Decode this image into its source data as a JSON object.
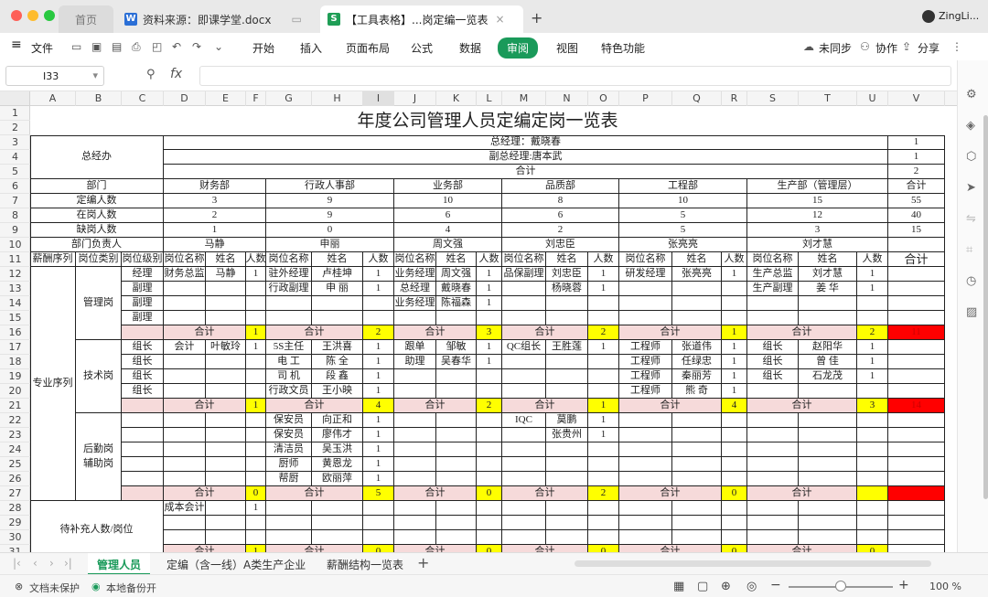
{
  "window": {
    "tabs": [
      {
        "label": "首页"
      },
      {
        "label": "资料来源：即课学堂.docx",
        "icon": "W"
      },
      {
        "label": "【工具表格】...岗定编一览表",
        "icon": "S"
      }
    ],
    "user": "ZingLi..."
  },
  "menu": {
    "file": "文件",
    "items": [
      "开始",
      "插入",
      "页面布局",
      "公式",
      "数据",
      "审阅",
      "视图",
      "特色功能"
    ],
    "active": "审阅",
    "sync": "未同步",
    "collab": "协作",
    "share": "分享"
  },
  "formula": {
    "namebox": "I33",
    "fx": "fx"
  },
  "columns": [
    "A",
    "B",
    "C",
    "D",
    "E",
    "F",
    "G",
    "H",
    "I",
    "J",
    "K",
    "L",
    "M",
    "N",
    "O",
    "P",
    "Q",
    "R",
    "S",
    "T",
    "U",
    "V"
  ],
  "rows": [
    "1",
    "2",
    "3",
    "4",
    "5",
    "6",
    "7",
    "8",
    "9",
    "10",
    "11",
    "12",
    "13",
    "14",
    "15",
    "16",
    "17",
    "18",
    "19",
    "20",
    "21",
    "22",
    "23",
    "24",
    "25",
    "26",
    "27",
    "28",
    "29",
    "30",
    "31"
  ],
  "sheet": {
    "title": "年度公司管理人员定编定岗一览表",
    "zongjingban": "总经办",
    "gm": "总经理：戴晓春",
    "vgm": "副总经理:唐本武",
    "heji": "合计",
    "gm_n": "1",
    "vgm_n": "1",
    "heji_n": "2",
    "dept_label": "部门",
    "depts": [
      "财务部",
      "行政人事部",
      "业务部",
      "品质部",
      "工程部",
      "生产部（管理层）"
    ],
    "dept_total": "合计",
    "quota_label": "定编人数",
    "quota": [
      "3",
      "9",
      "10",
      "8",
      "10",
      "15",
      "55"
    ],
    "onjob_label": "在岗人数",
    "onjob": [
      "2",
      "9",
      "6",
      "6",
      "5",
      "12",
      "40"
    ],
    "lack_label": "缺岗人数",
    "lack": [
      "1",
      "0",
      "4",
      "2",
      "5",
      "3",
      "15"
    ],
    "leader_label": "部门负责人",
    "leaders": [
      "马静",
      "申丽",
      "周文强",
      "刘忠臣",
      "张亮亮",
      "刘才慧"
    ],
    "hdr": {
      "pay": "薪酬序列",
      "cat": "岗位类别",
      "lvl": "岗位级别",
      "pos": "岗位名称",
      "name": "姓名",
      "cnt": "人数",
      "total": "合计"
    },
    "seq_pro": "专业序列",
    "cat_mgmt": "管理岗",
    "cat_tech": "技术岗",
    "cat_support": "后勤岗\n辅助岗",
    "lvl_mgr": "经理",
    "lvl_dep": "副理",
    "lvl_team": "组长",
    "r12": [
      "财务总监",
      "马静",
      "1",
      "驻外经理",
      "卢桂坤",
      "1",
      "业务经理",
      "周文强",
      "1",
      "品保副理",
      "刘忠臣",
      "1",
      "研发经理",
      "张亮亮",
      "1",
      "生产总监",
      "刘才慧",
      "1"
    ],
    "r13": [
      "行政副理",
      "申 丽",
      "1",
      "总经理",
      "戴晓春",
      "1",
      "杨晓蓉",
      "1",
      "生产副理",
      "姜 华",
      "1"
    ],
    "r14": [
      "业务经理",
      "陈福森",
      "1"
    ],
    "sub16": [
      "1",
      "2",
      "3",
      "2",
      "1",
      "2",
      "11"
    ],
    "r17": [
      "会计",
      "叶敏玲",
      "1",
      "5S主任",
      "王洪喜",
      "1",
      "跟单",
      "邹敏",
      "1",
      "QC组长",
      "王胜莲",
      "1",
      "工程师",
      "张道伟",
      "1",
      "组长",
      "赵阳华",
      "1"
    ],
    "r18": [
      "电 工",
      "陈 全",
      "1",
      "助理",
      "吴春华",
      "1",
      "工程师",
      "任绿忠",
      "1",
      "组长",
      "曾 佳",
      "1"
    ],
    "r19": [
      "司 机",
      "段 鑫",
      "1",
      "工程师",
      "秦丽芳",
      "1",
      "组长",
      "石龙茂",
      "1"
    ],
    "r20": [
      "行政文员",
      "王小映",
      "1",
      "工程师",
      "熊 奇",
      "1"
    ],
    "sub21": [
      "1",
      "4",
      "2",
      "1",
      "4",
      "3",
      "14"
    ],
    "r22": [
      "保安员",
      "向正和",
      "1",
      "IQC",
      "莫鹏",
      "1"
    ],
    "r23": [
      "保安员",
      "廖伟才",
      "1",
      "张贵州",
      "1"
    ],
    "r24": [
      "清洁员",
      "吴玉洪",
      "1"
    ],
    "r25": [
      "厨师",
      "黄恩龙",
      "1"
    ],
    "r26": [
      "帮厨",
      "欧丽萍",
      "1"
    ],
    "sub27": [
      "0",
      "5",
      "0",
      "2",
      "0",
      ""
    ],
    "pending": "待补充人数/岗位",
    "r28": [
      "成本会计",
      "1"
    ],
    "sub31": [
      "1",
      "0",
      "0",
      "0",
      "0",
      "0",
      "0"
    ]
  },
  "sheet_tabs": [
    "管理人员",
    "定编（含一线）A类生产企业",
    "薪酬结构一览表"
  ],
  "status": {
    "protect": "文档未保护",
    "backup": "本地备份开",
    "zoom": "100 %"
  }
}
